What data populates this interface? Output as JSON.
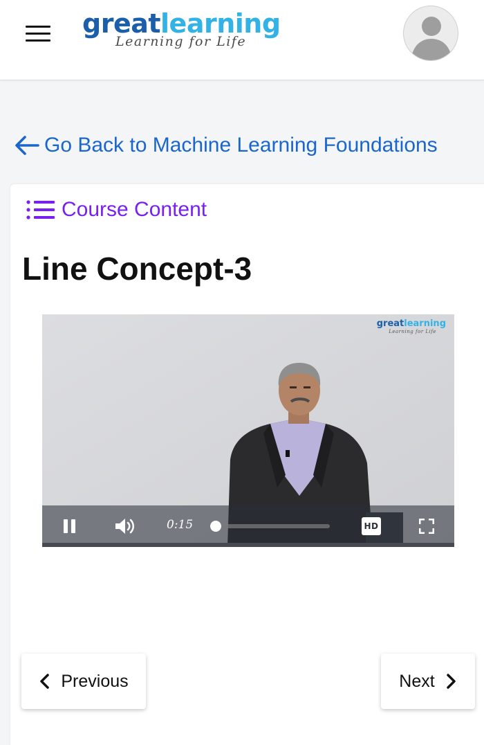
{
  "header": {
    "logo": {
      "great": "great",
      "learning": "learning",
      "tagline": "Learning for Life"
    }
  },
  "back_link": {
    "label": "Go Back to Machine Learning Foundations",
    "color": "#1a66cc"
  },
  "course_content": {
    "label": "Course Content",
    "color": "#7a1ff2"
  },
  "lesson": {
    "title": "Line Concept-3"
  },
  "video": {
    "watermark": {
      "great": "great",
      "learning": "learning",
      "tagline": "Learning for Life"
    },
    "current_time": "0:15",
    "progress_fraction": 0.02,
    "quality_badge": "HD"
  },
  "nav": {
    "previous_label": "Previous",
    "next_label": "Next"
  },
  "icons": [
    "menu-icon",
    "user-avatar-icon",
    "arrow-left-icon",
    "list-icon",
    "pause-icon",
    "volume-icon",
    "hd-icon",
    "fullscreen-icon",
    "chevron-left-icon",
    "chevron-right-icon"
  ]
}
